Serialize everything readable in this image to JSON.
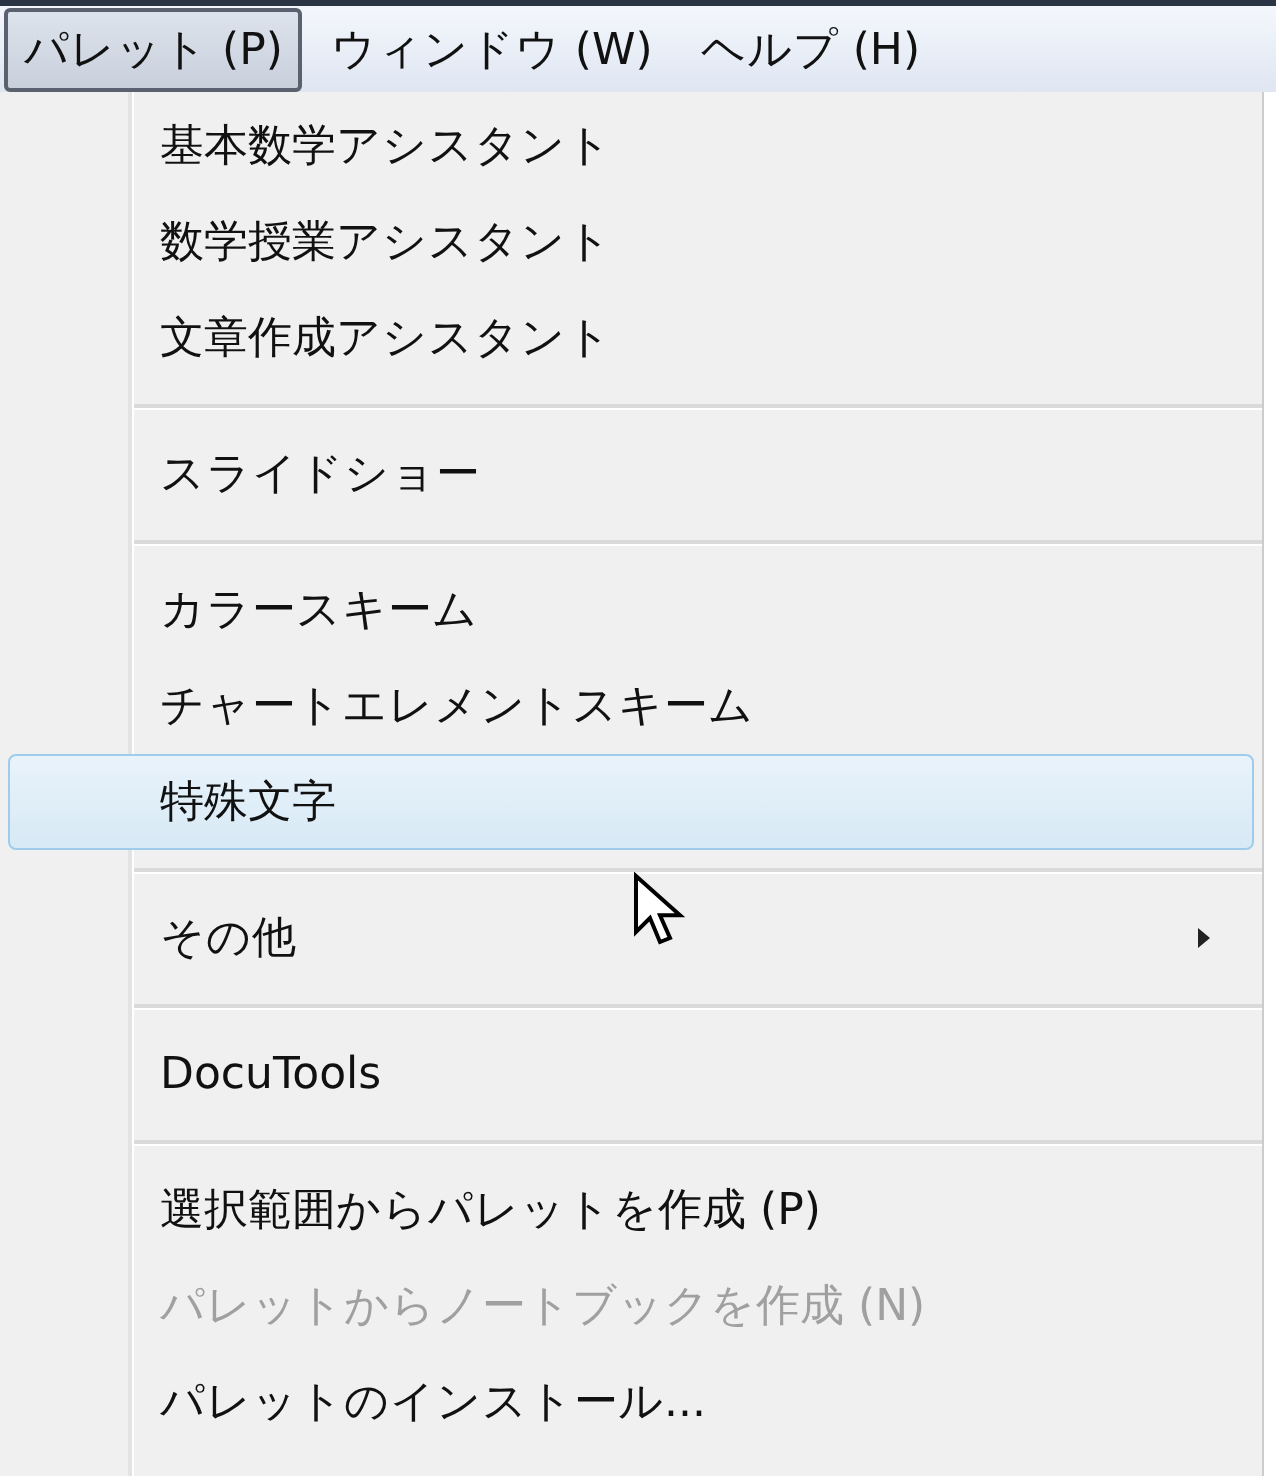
{
  "menu_bar": [
    {
      "label": "パレット (P)",
      "selected": true
    },
    {
      "label": "ウィンドウ (W)",
      "selected": false
    },
    {
      "label": "ヘルプ (H)",
      "selected": false
    }
  ],
  "menu": [
    {
      "kind": "item",
      "label": "基本数学アシスタント",
      "selected": false,
      "disabled": false
    },
    {
      "kind": "item",
      "label": "数学授業アシスタント",
      "selected": false,
      "disabled": false
    },
    {
      "kind": "item",
      "label": "文章作成アシスタント",
      "selected": false,
      "disabled": false
    },
    {
      "kind": "separator"
    },
    {
      "kind": "item",
      "label": "スライドショー",
      "selected": false,
      "disabled": false
    },
    {
      "kind": "separator"
    },
    {
      "kind": "item",
      "label": "カラースキーム",
      "selected": false,
      "disabled": false
    },
    {
      "kind": "item",
      "label": "チャートエレメントスキーム",
      "selected": false,
      "disabled": false
    },
    {
      "kind": "item",
      "label": "特殊文字",
      "selected": true,
      "disabled": false
    },
    {
      "kind": "separator"
    },
    {
      "kind": "submenu",
      "label": "その他",
      "selected": false,
      "disabled": false
    },
    {
      "kind": "separator"
    },
    {
      "kind": "item",
      "label": "DocuTools",
      "selected": false,
      "disabled": false
    },
    {
      "kind": "separator"
    },
    {
      "kind": "item",
      "label": "選択範囲からパレットを作成 (P)",
      "selected": false,
      "disabled": false
    },
    {
      "kind": "item",
      "label": "パレットからノートブックを作成 (N)",
      "selected": false,
      "disabled": true
    },
    {
      "kind": "item",
      "label": "パレットのインストール...",
      "selected": false,
      "disabled": false
    }
  ]
}
